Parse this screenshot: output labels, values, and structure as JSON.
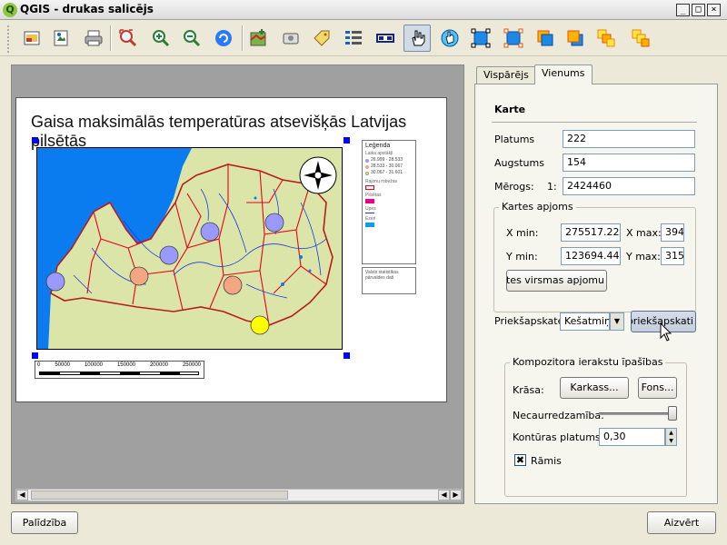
{
  "window": {
    "title": "QGIS - drukas salicējs",
    "logo_letter": "Q",
    "controls": [
      "_",
      "□",
      "×"
    ]
  },
  "toolbar": {
    "buttons": [
      {
        "name": "add-new-composer-icon"
      },
      {
        "name": "export-image-icon"
      },
      {
        "name": "print-icon"
      },
      {
        "name": "zoom-full-icon"
      },
      {
        "name": "zoom-in-icon"
      },
      {
        "name": "zoom-out-icon"
      },
      {
        "name": "refresh-icon"
      },
      {
        "name": "add-map-icon"
      },
      {
        "name": "add-image-icon"
      },
      {
        "name": "add-label-icon"
      },
      {
        "name": "add-legend-icon"
      },
      {
        "name": "add-scalebar-icon"
      },
      {
        "name": "select-move-icon"
      },
      {
        "name": "move-content-icon"
      },
      {
        "name": "group-icon"
      },
      {
        "name": "ungroup-icon"
      },
      {
        "name": "raise-icon"
      },
      {
        "name": "lower-icon"
      },
      {
        "name": "move-to-top-icon"
      },
      {
        "name": "move-to-bottom-icon"
      }
    ]
  },
  "composition": {
    "title": "Gaisa maksimālās temperatūras atsevišķās Latvijas pilsētās",
    "legend": {
      "title": "Leģenda",
      "group1": "Laika apstākļi",
      "classes": [
        {
          "label": "26.999 - 28.533",
          "color": "#9999ff"
        },
        {
          "label": "28.533 - 30.067",
          "color": "#f4a582"
        },
        {
          "label": "30.067 - 31.601",
          "color": "#ffff00"
        }
      ],
      "group2": "Rajonu robežas",
      "group3": "Pilsētas",
      "group4": "Upes",
      "group5": "Ezeri"
    },
    "data_source": "Valsts statistikas pārvaldes dati",
    "scale_labels": [
      "0",
      "50000",
      "100000",
      "150000",
      "200000",
      "250000"
    ],
    "colors": {
      "sea": "#0a7cf0",
      "land": "#dbe5a8",
      "border": "#e8001c",
      "river": "#1a3ce8"
    }
  },
  "panel": {
    "tabs": [
      {
        "label": "Vispārējs"
      },
      {
        "label": "Vienums"
      }
    ],
    "section_title": "Karte",
    "width_label": "Platums",
    "width_value": "222",
    "height_label": "Augstums",
    "height_value": "154",
    "scale_label": "Mērogs:",
    "scale_prefix": "1:",
    "scale_value": "2424460",
    "extent_group": "Kartes apjoms",
    "xmin_label": "X min:",
    "xmin_value": "275517.225",
    "xmax_label": "X max:",
    "xmax_value": "394",
    "ymin_label": "Y min:",
    "ymin_value": "123694.441",
    "ymax_label": "Y max:",
    "ymax_value": "315",
    "set_extent_button": "Iestatīt kā kartes virsmas apjomu",
    "preview_label": "Priekšapskate",
    "preview_value": "Kešatmiņa",
    "update_preview_button": "Atjaunināt priekšapskati",
    "props_group": "Kompozitora ierakstu īpašības",
    "color_label": "Krāsa:",
    "frame_button": "Karkass...",
    "background_button": "Fons...",
    "opacity_label": "Necaurredzamība:",
    "opacity_value": 0.95,
    "outline_label": "Kontūras platums",
    "outline_value": "0,30",
    "frame_check_label": "Rāmis",
    "frame_checked": true
  },
  "footer": {
    "help_button": "Palīdzība",
    "close_button": "Aizvērt"
  }
}
